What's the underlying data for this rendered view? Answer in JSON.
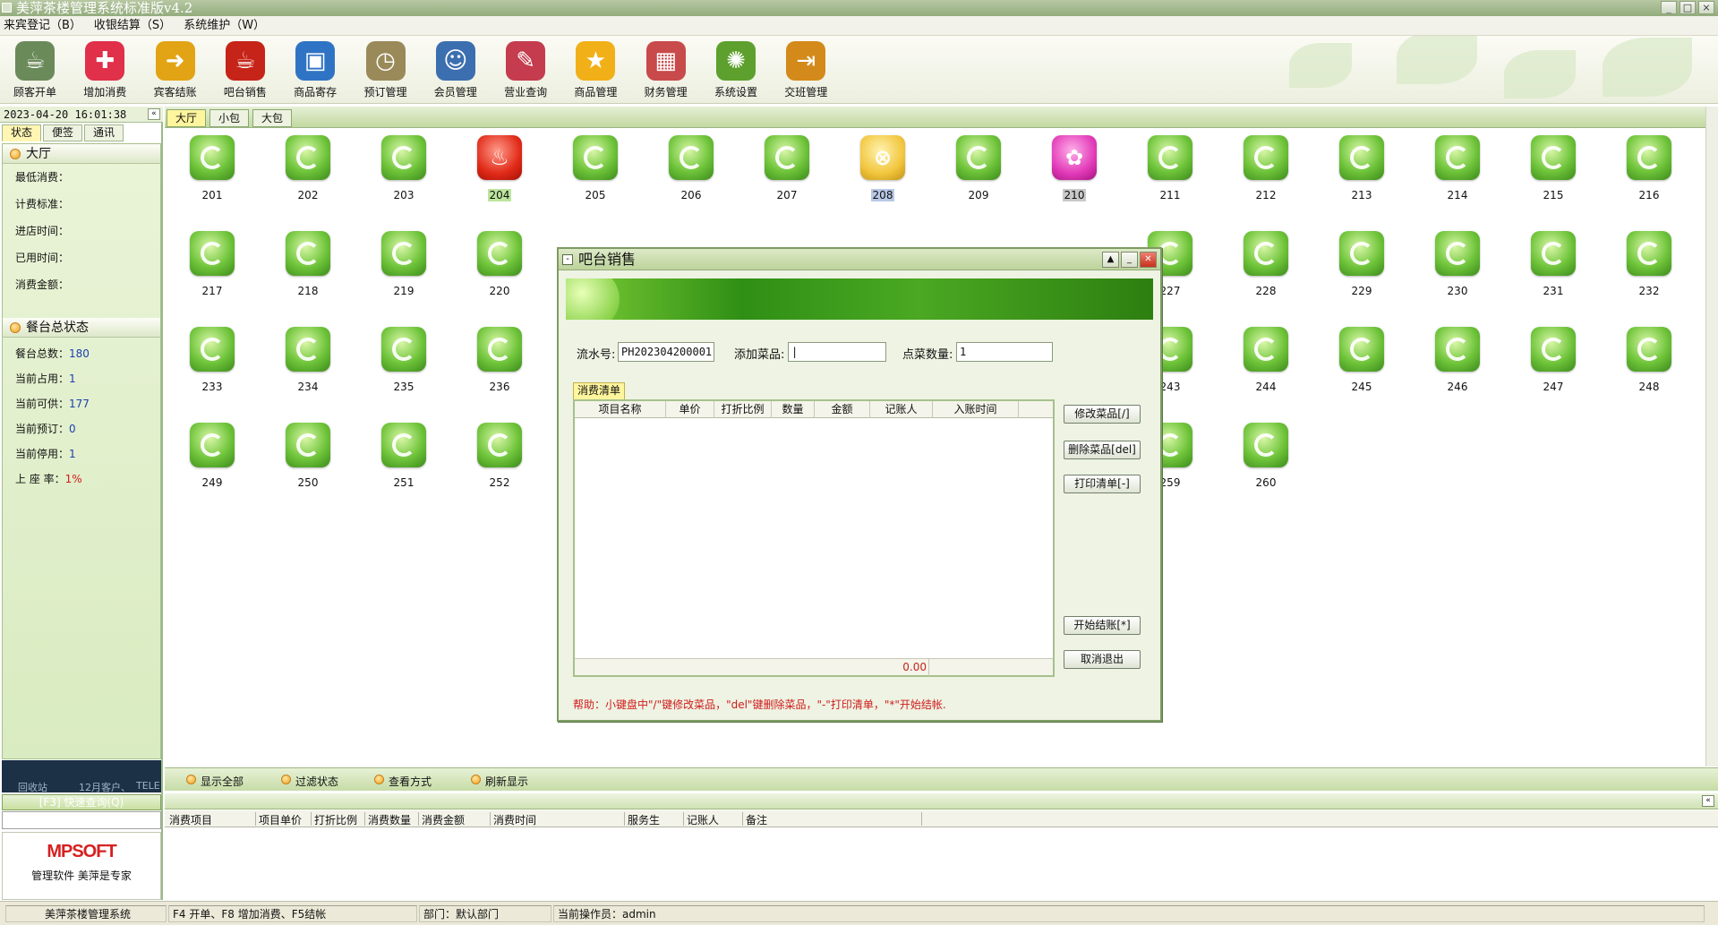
{
  "window": {
    "title": "美萍茶楼管理系统标准版v4.2",
    "controls": [
      "_",
      "□",
      "×"
    ]
  },
  "menu": [
    "来宾登记（B）",
    "收银结算（S）",
    "系统维护（W）"
  ],
  "toolbar": [
    {
      "label": "顾客开单",
      "icon": "teacup-icon",
      "color": "#6b8a5a"
    },
    {
      "label": "增加消费",
      "icon": "plus-icon",
      "color": "#e0304a"
    },
    {
      "label": "宾客结账",
      "icon": "arrow-right-icon",
      "color": "#e2a415"
    },
    {
      "label": "吧台销售",
      "icon": "cup-icon",
      "color": "#c62418"
    },
    {
      "label": "商品寄存",
      "icon": "basket-icon",
      "color": "#2f74c4"
    },
    {
      "label": "预订管理",
      "icon": "clock-icon",
      "color": "#9a8a5a"
    },
    {
      "label": "会员管理",
      "icon": "users-icon",
      "color": "#3c6fb0"
    },
    {
      "label": "营业查询",
      "icon": "magnifier-icon",
      "color": "#c43c4e"
    },
    {
      "label": "商品管理",
      "icon": "star-icon",
      "color": "#f2b018"
    },
    {
      "label": "财务管理",
      "icon": "calculator-icon",
      "color": "#c84a4a"
    },
    {
      "label": "系统设置",
      "icon": "gear-icon",
      "color": "#5da02e"
    },
    {
      "label": "交班管理",
      "icon": "exit-icon",
      "color": "#d48a1a"
    }
  ],
  "left": {
    "datetime": "2023-04-20 16:01:38",
    "tabs": [
      "状态",
      "便签",
      "通讯"
    ],
    "hall_section": "大厅",
    "hall_fields": [
      "最低消费：",
      "计费标准：",
      "进店时间：",
      "已用时间：",
      "消费金额："
    ],
    "summary_section": "餐台总状态",
    "summary": [
      {
        "label": "餐台总数：",
        "value": "180"
      },
      {
        "label": "当前占用：",
        "value": "1"
      },
      {
        "label": "当前可供：",
        "value": "177"
      },
      {
        "label": "当前预订：",
        "value": "0"
      },
      {
        "label": "当前停用：",
        "value": "1"
      },
      {
        "label": "上 座 率：",
        "value": "1%"
      }
    ],
    "taskbar_items": [
      "回收站",
      "12月客户、",
      "TELE"
    ],
    "quick_search": "[F3] 快速查询(Q)",
    "logo": "MPSOFT",
    "slogan": "管理软件 美萍是专家"
  },
  "area_tabs": [
    "大厅",
    "小包",
    "大包"
  ],
  "tables": [
    {
      "no": "201",
      "status": "free"
    },
    {
      "no": "202",
      "status": "free"
    },
    {
      "no": "203",
      "status": "free"
    },
    {
      "no": "204",
      "status": "occupied"
    },
    {
      "no": "205",
      "status": "free"
    },
    {
      "no": "206",
      "status": "free"
    },
    {
      "no": "207",
      "status": "free"
    },
    {
      "no": "208",
      "status": "reserved"
    },
    {
      "no": "209",
      "status": "free"
    },
    {
      "no": "210",
      "status": "stopped"
    },
    {
      "no": "211",
      "status": "free"
    },
    {
      "no": "212",
      "status": "free"
    },
    {
      "no": "213",
      "status": "free"
    },
    {
      "no": "214",
      "status": "free"
    },
    {
      "no": "215",
      "status": "free"
    },
    {
      "no": "216",
      "status": "free"
    },
    {
      "no": "217",
      "status": "free"
    },
    {
      "no": "218",
      "status": "free"
    },
    {
      "no": "219",
      "status": "free"
    },
    {
      "no": "220",
      "status": "free"
    },
    {
      "no": "227",
      "status": "free"
    },
    {
      "no": "228",
      "status": "free"
    },
    {
      "no": "229",
      "status": "free"
    },
    {
      "no": "230",
      "status": "free"
    },
    {
      "no": "231",
      "status": "free"
    },
    {
      "no": "232",
      "status": "free"
    },
    {
      "no": "233",
      "status": "free"
    },
    {
      "no": "234",
      "status": "free"
    },
    {
      "no": "235",
      "status": "free"
    },
    {
      "no": "236",
      "status": "free"
    },
    {
      "no": "243",
      "status": "free"
    },
    {
      "no": "244",
      "status": "free"
    },
    {
      "no": "245",
      "status": "free"
    },
    {
      "no": "246",
      "status": "free"
    },
    {
      "no": "247",
      "status": "free"
    },
    {
      "no": "248",
      "status": "free"
    },
    {
      "no": "249",
      "status": "free"
    },
    {
      "no": "250",
      "status": "free"
    },
    {
      "no": "251",
      "status": "free"
    },
    {
      "no": "252",
      "status": "free"
    },
    {
      "no": "259",
      "status": "free"
    },
    {
      "no": "260",
      "status": "free"
    }
  ],
  "bottom_actions": [
    "显示全部",
    "过滤状态",
    "查看方式",
    "刷新显示"
  ],
  "detail_columns": [
    "消费项目",
    "项目单价",
    "打折比例",
    "消费数量",
    "消费金额",
    "消费时间",
    "服务生",
    "记账人",
    "备注"
  ],
  "status_bar": [
    "美萍茶楼管理系统",
    "F4 开单、F8 增加消费、F5结帐",
    "部门：默认部门",
    "当前操作员：admin"
  ],
  "dialog": {
    "title": "吧台销售",
    "serial_label": "流水号:",
    "serial_value": "PH202304200001",
    "add_item_label": "添加菜品:",
    "add_item_value": "",
    "qty_label": "点菜数量:",
    "qty_value": "1",
    "list_tab": "消费清单",
    "columns": [
      "项目名称",
      "单价",
      "打折比例",
      "数量",
      "金额",
      "记账人",
      "入账时间"
    ],
    "total": "0.00",
    "buttons": [
      "修改菜品[/]",
      "删除菜品[del]",
      "打印清单[-]",
      "开始结账[*]",
      "取消退出"
    ],
    "help": "帮助：小键盘中\"/\"键修改菜品，\"del\"键删除菜品，\"-\"打印清单，\"*\"开始结帐."
  }
}
